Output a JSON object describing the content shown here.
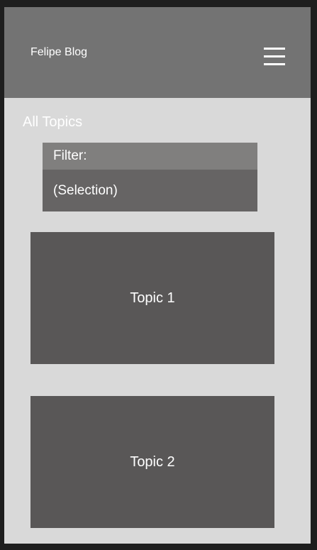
{
  "header": {
    "brand": "Felipe Blog",
    "menu_icon": "hamburger-menu-icon"
  },
  "main": {
    "section_title": "All Topics",
    "filter": {
      "label": "Filter:",
      "value": "(Selection)"
    },
    "topics": [
      {
        "label": "Topic 1"
      },
      {
        "label": "Topic 2"
      }
    ]
  },
  "colors": {
    "page_background": "#1e1e1e",
    "frame_background": "#d9d9d9",
    "header_background": "#737373",
    "filter_label_background": "#807f7e",
    "filter_value_background": "#666464",
    "card_background": "#595757",
    "text": "#ffffff"
  }
}
